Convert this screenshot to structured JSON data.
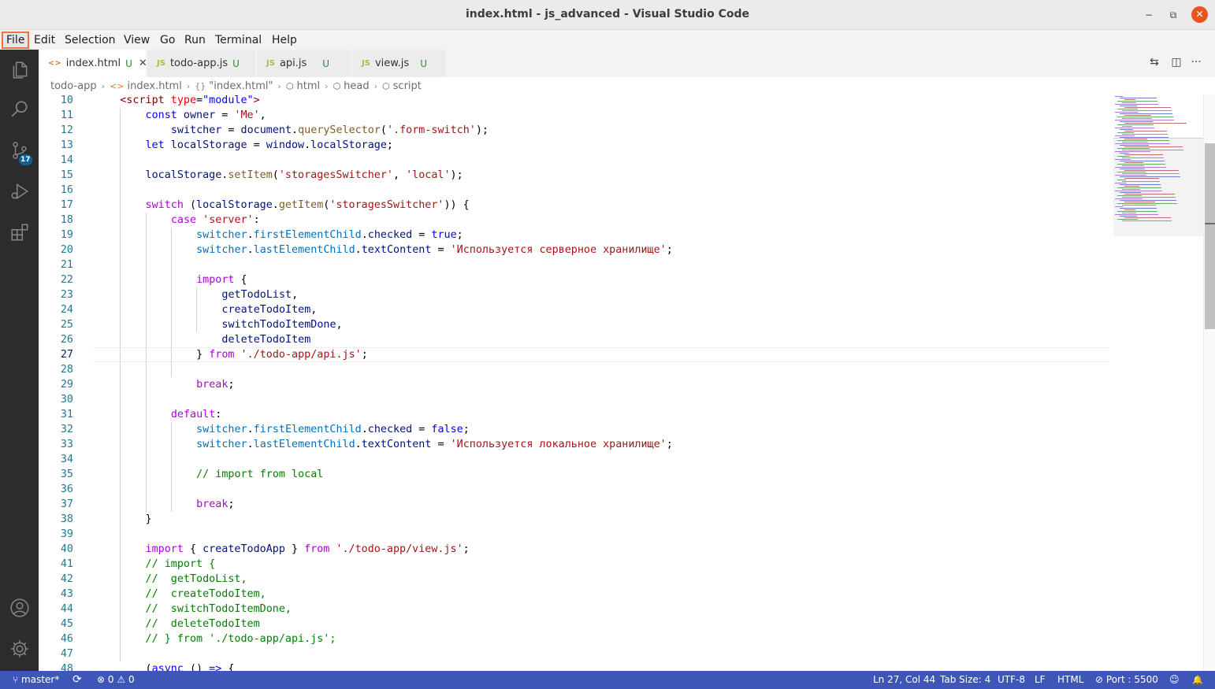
{
  "window": {
    "title": "index.html - js_advanced - Visual Studio Code",
    "min_icon": "minimize-icon",
    "max_icon": "restore-icon",
    "close_icon": "close-icon",
    "min_glyph": "−",
    "max_glyph": "⧉",
    "close_glyph": "✕"
  },
  "menu": {
    "items": [
      {
        "label": "File",
        "active": true
      },
      {
        "label": "Edit"
      },
      {
        "label": "Selection"
      },
      {
        "label": "View"
      },
      {
        "label": "Go"
      },
      {
        "label": "Run"
      },
      {
        "label": "Terminal"
      },
      {
        "label": "Help"
      }
    ]
  },
  "activitybar": {
    "items": [
      "explorer-icon",
      "search-icon",
      "source-control-icon",
      "run-debug-icon",
      "extensions-icon"
    ],
    "source_control_badge": "17",
    "bottom": [
      "accounts-icon",
      "manage-gear-icon"
    ]
  },
  "tabs": [
    {
      "icon": "<>",
      "label": "index.html",
      "status": "U",
      "active": true,
      "close": "✕",
      "icon_color": "#e37933"
    },
    {
      "icon": "JS",
      "label": "todo-app.js",
      "status": "U",
      "icon_color": "#b7b73b"
    },
    {
      "icon": "JS",
      "label": "api.js",
      "status": "U",
      "icon_color": "#b7b73b"
    },
    {
      "icon": "JS",
      "label": "view.js",
      "status": "U",
      "icon_color": "#b7b73b"
    }
  ],
  "editor_actions": {
    "compare": "⇆",
    "split": "◫",
    "more": "···"
  },
  "breadcrumb": {
    "items": [
      {
        "icon": "",
        "label": "todo-app"
      },
      {
        "icon": "<>",
        "label": "index.html"
      },
      {
        "icon": "{}",
        "label": "\"index.html\""
      },
      {
        "icon": "⬡",
        "label": "html"
      },
      {
        "icon": "⬡",
        "label": "head"
      },
      {
        "icon": "⬡",
        "label": "script"
      }
    ],
    "separator": "›"
  },
  "editor": {
    "current_line": 27,
    "lines": [
      {
        "n": 10,
        "indent": 1,
        "tokens": [
          [
            "t",
            "<script "
          ],
          [
            "a",
            "type"
          ],
          [
            "n",
            "="
          ],
          [
            "b",
            "\"module\""
          ],
          [
            "t",
            ">"
          ]
        ]
      },
      {
        "n": 11,
        "indent": 2,
        "tokens": [
          [
            "b",
            "const "
          ],
          [
            "v",
            "owner"
          ],
          [
            "n",
            " = "
          ],
          [
            "s",
            "'Me'"
          ],
          [
            "n",
            ","
          ]
        ]
      },
      {
        "n": 12,
        "indent": 3,
        "tokens": [
          [
            "v",
            "switcher"
          ],
          [
            "n",
            " = "
          ],
          [
            "v",
            "document"
          ],
          [
            "n",
            "."
          ],
          [
            "f",
            "querySelector"
          ],
          [
            "n",
            "("
          ],
          [
            "s",
            "'.form-switch'"
          ],
          [
            "n",
            ");"
          ]
        ]
      },
      {
        "n": 13,
        "indent": 2,
        "tokens": [
          [
            "b",
            "let "
          ],
          [
            "v",
            "localStorage"
          ],
          [
            "n",
            " = "
          ],
          [
            "v",
            "window"
          ],
          [
            "n",
            "."
          ],
          [
            "v",
            "localStorage"
          ],
          [
            "n",
            ";"
          ]
        ]
      },
      {
        "n": 14,
        "indent": 0,
        "tokens": []
      },
      {
        "n": 15,
        "indent": 2,
        "tokens": [
          [
            "v",
            "localStorage"
          ],
          [
            "n",
            "."
          ],
          [
            "f",
            "setItem"
          ],
          [
            "n",
            "("
          ],
          [
            "s",
            "'storagesSwitcher'"
          ],
          [
            "n",
            ", "
          ],
          [
            "s",
            "'local'"
          ],
          [
            "n",
            ");"
          ]
        ]
      },
      {
        "n": 16,
        "indent": 0,
        "tokens": []
      },
      {
        "n": 17,
        "indent": 2,
        "tokens": [
          [
            "k",
            "switch"
          ],
          [
            "n",
            " ("
          ],
          [
            "v",
            "localStorage"
          ],
          [
            "n",
            "."
          ],
          [
            "f",
            "getItem"
          ],
          [
            "n",
            "("
          ],
          [
            "s",
            "'storagesSwitcher'"
          ],
          [
            "n",
            ")) {"
          ]
        ]
      },
      {
        "n": 18,
        "indent": 3,
        "tokens": [
          [
            "k",
            "case "
          ],
          [
            "s",
            "'server'"
          ],
          [
            "n",
            ":"
          ]
        ]
      },
      {
        "n": 19,
        "indent": 4,
        "tokens": [
          [
            "l",
            "switcher"
          ],
          [
            "n",
            "."
          ],
          [
            "l",
            "firstElementChild"
          ],
          [
            "n",
            "."
          ],
          [
            "v",
            "checked"
          ],
          [
            "n",
            " = "
          ],
          [
            "b",
            "true"
          ],
          [
            "n",
            ";"
          ]
        ]
      },
      {
        "n": 20,
        "indent": 4,
        "tokens": [
          [
            "l",
            "switcher"
          ],
          [
            "n",
            "."
          ],
          [
            "l",
            "lastElementChild"
          ],
          [
            "n",
            "."
          ],
          [
            "v",
            "textContent"
          ],
          [
            "n",
            " = "
          ],
          [
            "s",
            "'Используется серверное хранилище'"
          ],
          [
            "n",
            ";"
          ]
        ]
      },
      {
        "n": 21,
        "indent": 0,
        "tokens": []
      },
      {
        "n": 22,
        "indent": 4,
        "tokens": [
          [
            "k",
            "import"
          ],
          [
            "n",
            " {"
          ]
        ]
      },
      {
        "n": 23,
        "indent": 5,
        "tokens": [
          [
            "v",
            "getTodoList"
          ],
          [
            "n",
            ","
          ]
        ]
      },
      {
        "n": 24,
        "indent": 5,
        "tokens": [
          [
            "v",
            "createTodoItem"
          ],
          [
            "n",
            ","
          ]
        ]
      },
      {
        "n": 25,
        "indent": 5,
        "tokens": [
          [
            "v",
            "switchTodoItemDone"
          ],
          [
            "n",
            ","
          ]
        ]
      },
      {
        "n": 26,
        "indent": 5,
        "tokens": [
          [
            "v",
            "deleteTodoItem"
          ]
        ]
      },
      {
        "n": 27,
        "indent": 4,
        "tokens": [
          [
            "n",
            "} "
          ],
          [
            "k",
            "from"
          ],
          [
            "n",
            " "
          ],
          [
            "s",
            "'./todo-app/api.js'"
          ],
          [
            "n",
            ";"
          ]
        ]
      },
      {
        "n": 28,
        "indent": 0,
        "tokens": []
      },
      {
        "n": 29,
        "indent": 4,
        "tokens": [
          [
            "k",
            "break"
          ],
          [
            "n",
            ";"
          ]
        ]
      },
      {
        "n": 30,
        "indent": 0,
        "tokens": []
      },
      {
        "n": 31,
        "indent": 3,
        "tokens": [
          [
            "k",
            "default"
          ],
          [
            "n",
            ":"
          ]
        ]
      },
      {
        "n": 32,
        "indent": 4,
        "tokens": [
          [
            "l",
            "switcher"
          ],
          [
            "n",
            "."
          ],
          [
            "l",
            "firstElementChild"
          ],
          [
            "n",
            "."
          ],
          [
            "v",
            "checked"
          ],
          [
            "n",
            " = "
          ],
          [
            "b",
            "false"
          ],
          [
            "n",
            ";"
          ]
        ]
      },
      {
        "n": 33,
        "indent": 4,
        "tokens": [
          [
            "l",
            "switcher"
          ],
          [
            "n",
            "."
          ],
          [
            "l",
            "lastElementChild"
          ],
          [
            "n",
            "."
          ],
          [
            "v",
            "textContent"
          ],
          [
            "n",
            " = "
          ],
          [
            "s",
            "'Используется локальное хранилище'"
          ],
          [
            "n",
            ";"
          ]
        ]
      },
      {
        "n": 34,
        "indent": 0,
        "tokens": []
      },
      {
        "n": 35,
        "indent": 4,
        "tokens": [
          [
            "c",
            "// import from local"
          ]
        ]
      },
      {
        "n": 36,
        "indent": 0,
        "tokens": []
      },
      {
        "n": 37,
        "indent": 4,
        "tokens": [
          [
            "k",
            "break"
          ],
          [
            "n",
            ";"
          ]
        ]
      },
      {
        "n": 38,
        "indent": 2,
        "tokens": [
          [
            "n",
            "}"
          ]
        ]
      },
      {
        "n": 39,
        "indent": 0,
        "tokens": []
      },
      {
        "n": 40,
        "indent": 2,
        "tokens": [
          [
            "k",
            "import"
          ],
          [
            "n",
            " { "
          ],
          [
            "v",
            "createTodoApp"
          ],
          [
            "n",
            " } "
          ],
          [
            "k",
            "from"
          ],
          [
            "n",
            " "
          ],
          [
            "s",
            "'./todo-app/view.js'"
          ],
          [
            "n",
            ";"
          ]
        ]
      },
      {
        "n": 41,
        "indent": 2,
        "tokens": [
          [
            "c",
            "// import {"
          ]
        ]
      },
      {
        "n": 42,
        "indent": 2,
        "tokens": [
          [
            "c",
            "//  getTodoList,"
          ]
        ]
      },
      {
        "n": 43,
        "indent": 2,
        "tokens": [
          [
            "c",
            "//  createTodoItem,"
          ]
        ]
      },
      {
        "n": 44,
        "indent": 2,
        "tokens": [
          [
            "c",
            "//  switchTodoItemDone,"
          ]
        ]
      },
      {
        "n": 45,
        "indent": 2,
        "tokens": [
          [
            "c",
            "//  deleteTodoItem"
          ]
        ]
      },
      {
        "n": 46,
        "indent": 2,
        "tokens": [
          [
            "c",
            "// } from './todo-app/api.js';"
          ]
        ]
      },
      {
        "n": 47,
        "indent": 0,
        "tokens": []
      },
      {
        "n": 48,
        "indent": 2,
        "tokens": [
          [
            "n",
            "("
          ],
          [
            "b",
            "async"
          ],
          [
            "n",
            " () "
          ],
          [
            "b",
            "=>"
          ],
          [
            "n",
            " {"
          ]
        ]
      }
    ]
  },
  "statusbar": {
    "branch": "master*",
    "branch_icon": "⑂",
    "sync_icon": "⟳",
    "errors": "0",
    "warnings": "0",
    "error_icon": "⊗",
    "warning_icon": "⚠",
    "position": "Ln 27, Col 44",
    "tab_size": "Tab Size: 4",
    "encoding": "UTF-8",
    "eol": "LF",
    "language": "HTML",
    "port": "Port : 5500",
    "port_icon": "⊘",
    "feedback_icon": "☺",
    "bell_icon": "🔔"
  }
}
